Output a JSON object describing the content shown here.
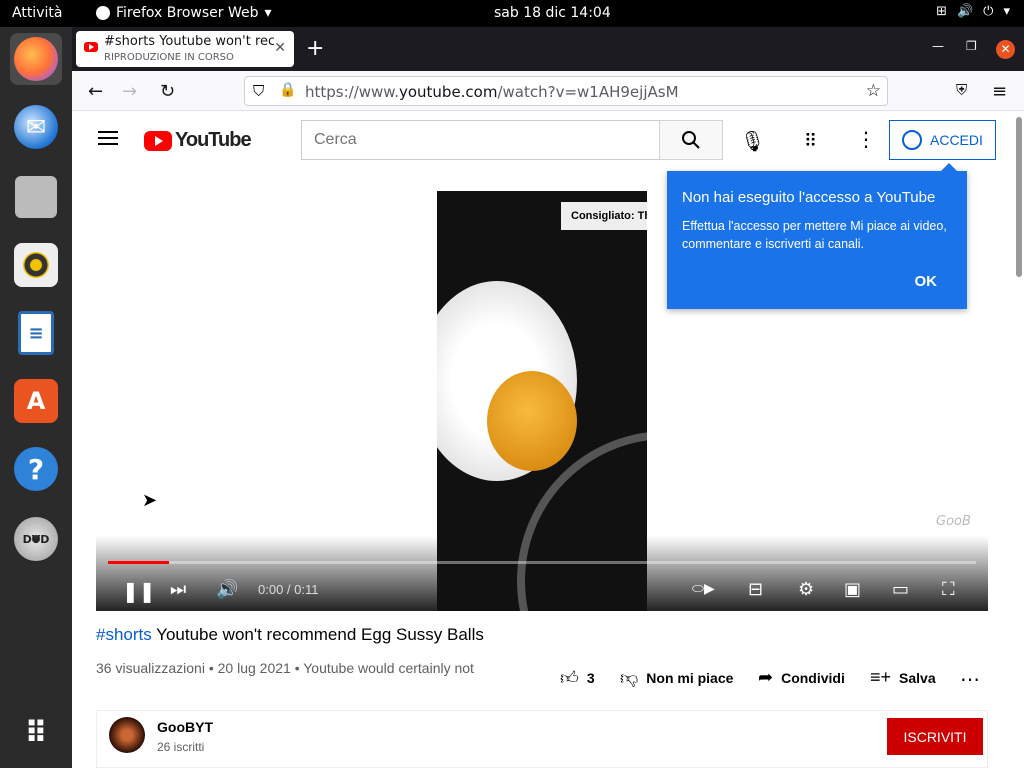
{
  "topbar": {
    "activities": "Attività",
    "app_name": "Firefox Browser Web",
    "clock": "sab 18 dic  14:04"
  },
  "dock": {
    "items": [
      "firefox",
      "thunderbird",
      "files",
      "rhythmbox",
      "libreoffice-writer",
      "ubuntu-software",
      "help",
      "dvd",
      "show-apps"
    ]
  },
  "browser": {
    "tab": {
      "title": "#shorts Youtube won't recommend Egg Sussy Balls",
      "subtitle": "RIPRODUZIONE IN CORSO"
    },
    "url_prefix": "https://www.",
    "url_domain": "youtube.com",
    "url_path": "/watch?v=w1AH9ejjAsM"
  },
  "youtube": {
    "logo_text": "YouTube",
    "search_placeholder": "Cerca",
    "signin_label": "ACCEDI",
    "popup": {
      "title": "Non hai eseguito l'accesso a YouTube",
      "body": "Effettua l'accesso per mettere Mi piace ai video, commentare e iscriverti ai canali.",
      "ok": "OK"
    },
    "player": {
      "suggestion": "Consigliato: The B",
      "watermark": "GooB",
      "time": "0:00 / 0:11",
      "progress": 0.07
    },
    "video": {
      "hashtag": "#shorts",
      "title": " Youtube won't recommend Egg Sussy Balls",
      "meta": "36 visualizzazioni • 20 lug 2021 • Youtube would certainly not",
      "likes": "3",
      "dislike_label": "Non mi piace",
      "share_label": "Condividi",
      "save_label": "Salva"
    },
    "channel": {
      "name": "GooBYT",
      "subscribers": "26 iscritti",
      "subscribe_label": "ISCRIVITI"
    }
  },
  "colors": {
    "yt_red": "#ff0000",
    "popup_blue": "#1a73e8",
    "link_blue": "#065fd4",
    "subscribe_red": "#cc0000",
    "ubuntu_orange": "#e95420"
  }
}
